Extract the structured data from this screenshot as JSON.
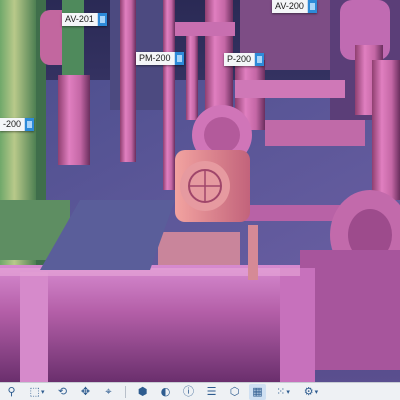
{
  "tags": [
    {
      "id": "av201",
      "label": "AV-201"
    },
    {
      "id": "av200",
      "label": "AV-200"
    },
    {
      "id": "pm200",
      "label": "PM-200"
    },
    {
      "id": "p200",
      "label": "P-200"
    },
    {
      "id": "left200",
      "label": "-200"
    }
  ],
  "toolbar": {
    "left_tools": [
      {
        "name": "search-icon",
        "glyph": "⚲",
        "has_dropdown": false
      },
      {
        "name": "cube-view-icon",
        "glyph": "⬚",
        "has_dropdown": true
      },
      {
        "name": "rotate-icon",
        "glyph": "⟲",
        "has_dropdown": false
      },
      {
        "name": "pan-icon",
        "glyph": "✥",
        "has_dropdown": false
      },
      {
        "name": "measure-icon",
        "glyph": "⌖",
        "has_dropdown": false
      }
    ],
    "right_tools": [
      {
        "name": "model-icon",
        "glyph": "⬢",
        "has_dropdown": false,
        "active": false
      },
      {
        "name": "section-icon",
        "glyph": "◐",
        "has_dropdown": false,
        "active": false
      },
      {
        "name": "info-icon",
        "glyph": "ⓘ",
        "has_dropdown": false,
        "active": false
      },
      {
        "name": "layers-icon",
        "glyph": "☰",
        "has_dropdown": false,
        "active": false
      },
      {
        "name": "explode-icon",
        "glyph": "⬡",
        "has_dropdown": false,
        "active": false
      },
      {
        "name": "grid-icon",
        "glyph": "▦",
        "has_dropdown": false,
        "active": true
      },
      {
        "name": "dots-grid-icon",
        "glyph": "⁙",
        "has_dropdown": true,
        "active": false
      },
      {
        "name": "settings-icon",
        "glyph": "⚙",
        "has_dropdown": true,
        "active": false
      }
    ]
  }
}
